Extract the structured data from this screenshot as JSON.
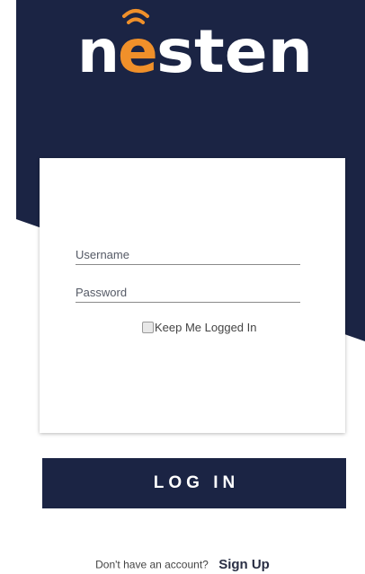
{
  "app": {
    "logo_text_left": "n",
    "logo_text_accent": "e",
    "logo_text_right": "sten"
  },
  "colors": {
    "navy": "#1b2444",
    "accent_orange": "#f0902a",
    "white": "#ffffff"
  },
  "icons": {
    "logo_wifi": "wifi-signal-icon"
  },
  "login_form": {
    "username_placeholder": "Username",
    "username_value": "",
    "password_placeholder": "Password",
    "password_value": "",
    "remember_label": "Keep Me Logged In",
    "remember_checked": false
  },
  "login_button": {
    "label": "LOG IN"
  },
  "footer": {
    "prompt": "Don't have an account?",
    "signup_label": "Sign Up"
  }
}
